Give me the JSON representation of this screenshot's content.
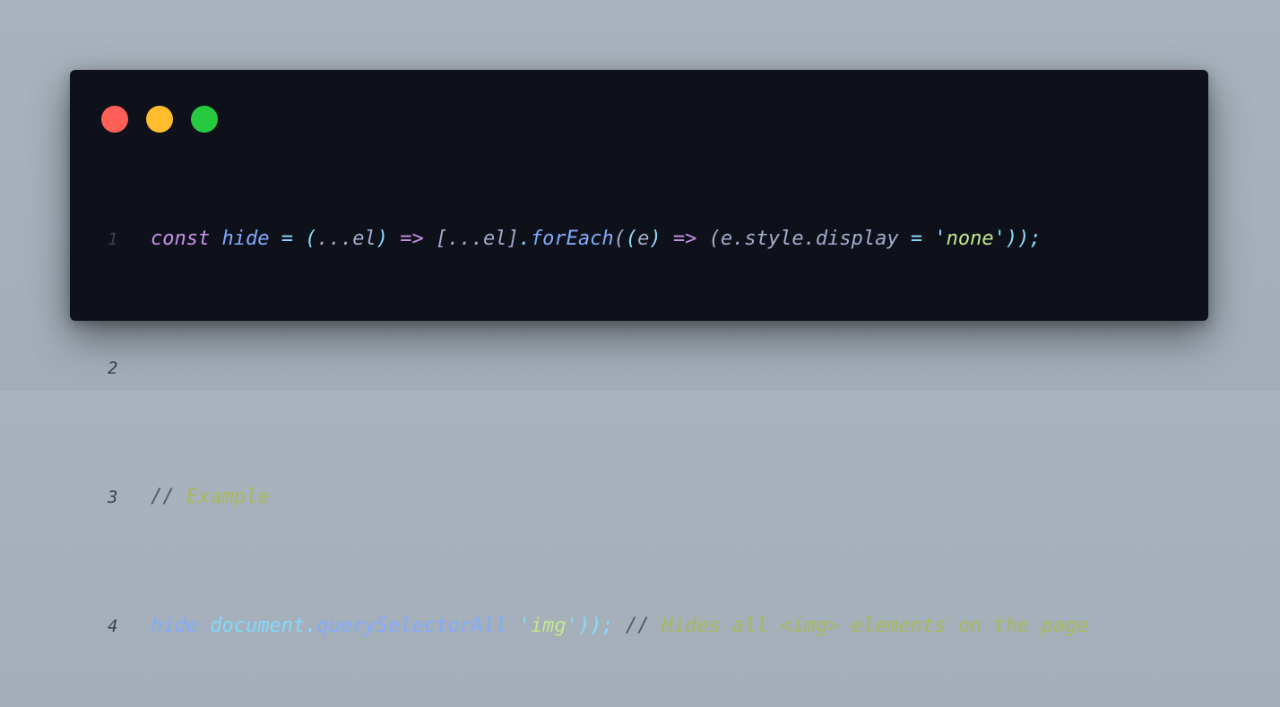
{
  "window": {
    "controls": [
      {
        "name": "close",
        "color": "#ff5f56"
      },
      {
        "name": "minimize",
        "color": "#ffbd2e"
      },
      {
        "name": "maximize",
        "color": "#27c93f"
      }
    ]
  },
  "code": {
    "line_numbers": [
      "1",
      "2",
      "3",
      "4"
    ],
    "line1": {
      "const": "const",
      "name": "hide",
      "eq": "=",
      "paren_open": "(",
      "param": "...el",
      "paren_close": ")",
      "arrow": "=>",
      "bracket_open": "[",
      "spread": "...el",
      "bracket_close": "]",
      "dot": ".",
      "method": "forEach",
      "call_open": "(",
      "inner_open": "(",
      "inner_param": "e",
      "inner_close": ")",
      "arrow2": "=>",
      "group_open": "(",
      "expr": "e.style.display",
      "eq2": "=",
      "quote_open": "'",
      "value": "none",
      "quote_close": "'",
      "tail": "));"
    },
    "line3": {
      "comment_slashes": "//",
      "comment_text": "Example"
    },
    "line4": {
      "fn": "hide",
      "open": "(",
      "obj": "document",
      "dot": ".",
      "method": "querySelectorAll",
      "call_open": "(",
      "quote_open": "'",
      "arg": "img",
      "quote_close": "'",
      "tail": "));",
      "comment_slashes": "//",
      "comment_text": "Hides all <img> elements on the page"
    }
  }
}
